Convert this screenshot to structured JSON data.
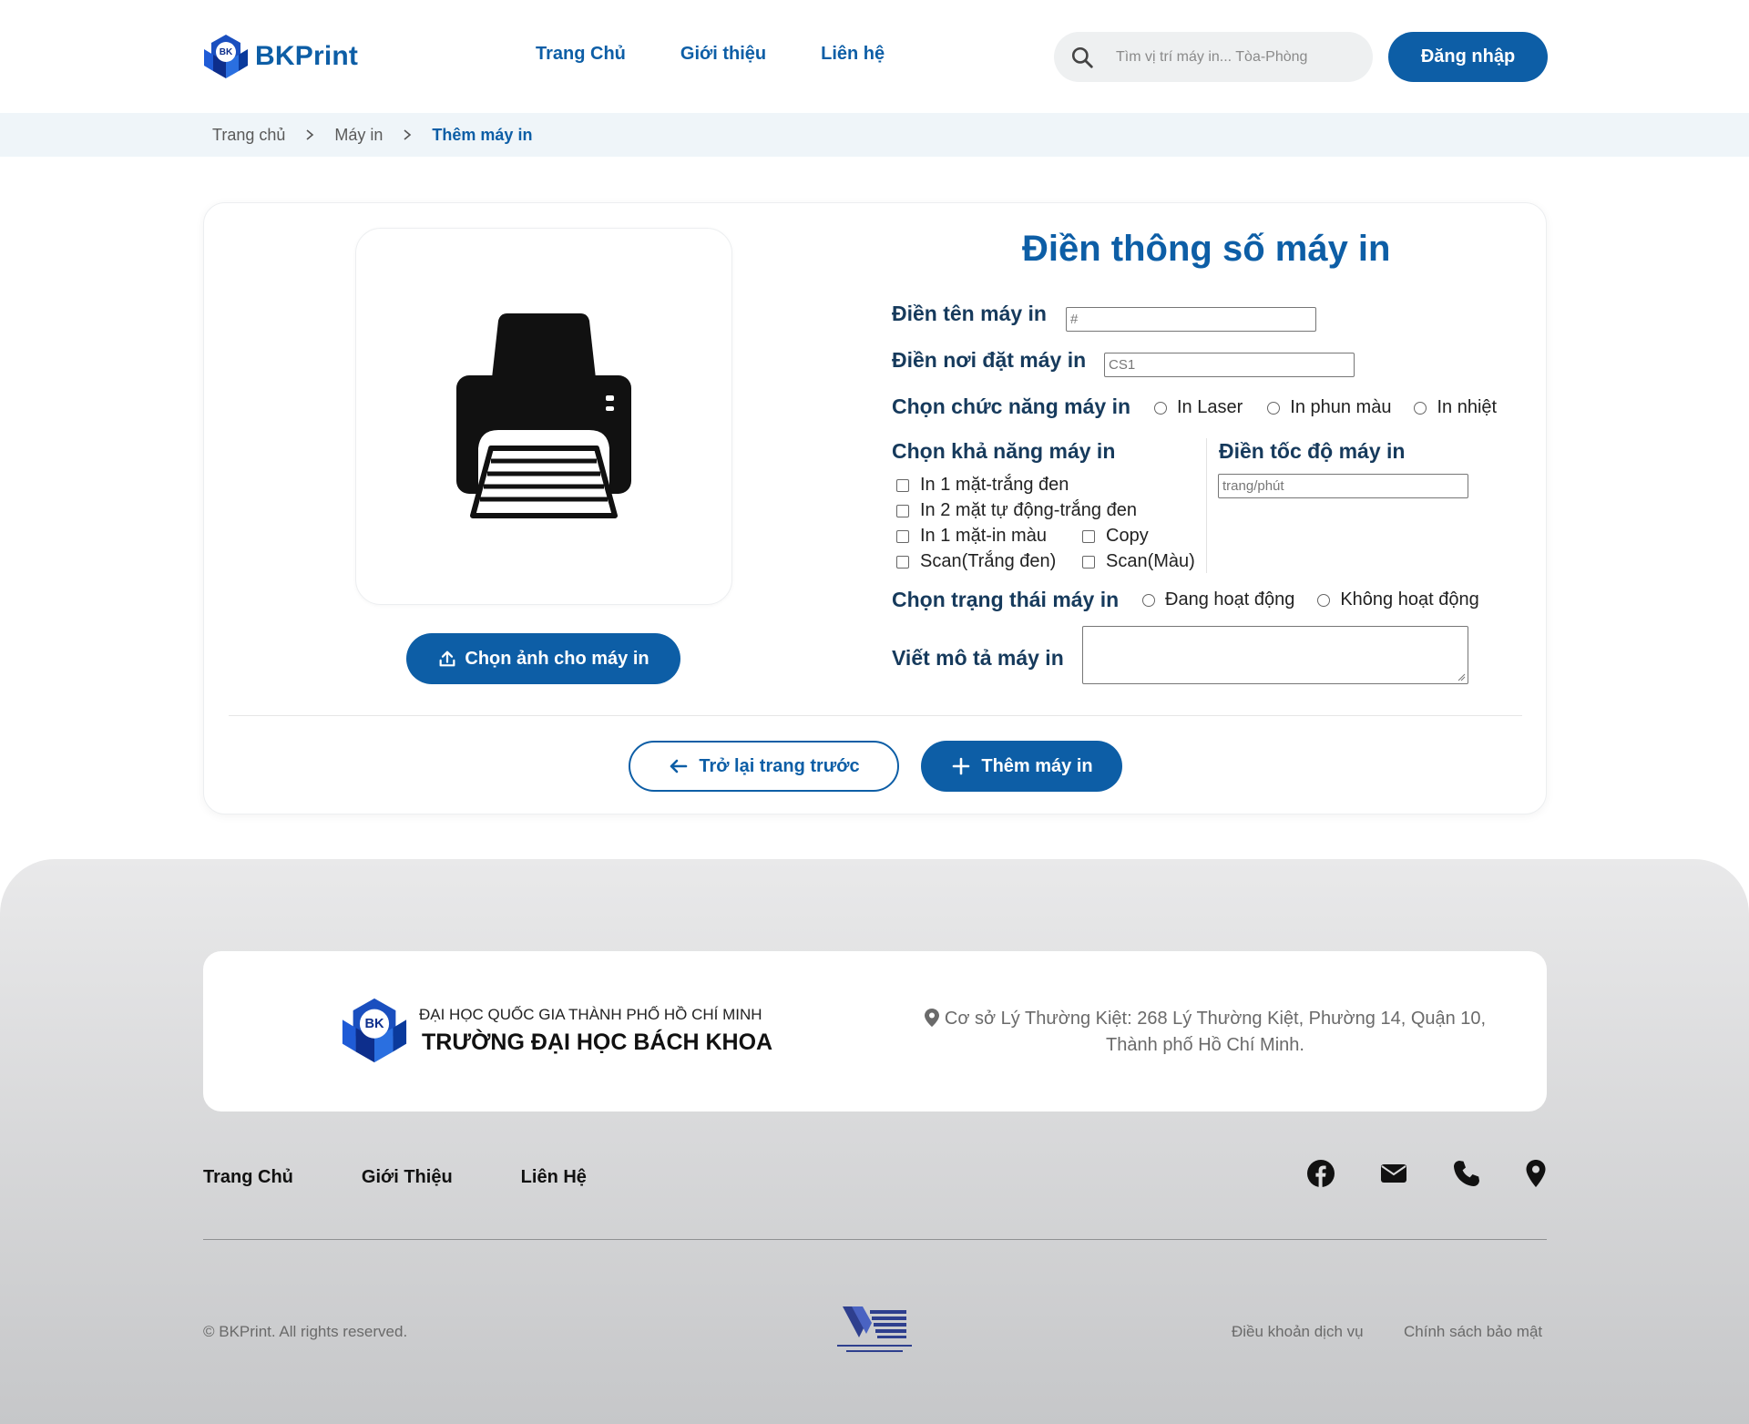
{
  "header": {
    "brand": "BKPrint",
    "nav": [
      "Trang Chủ",
      "Giới thiệu",
      "Liên hệ"
    ],
    "search_placeholder": "Tìm vị trí máy in... Tòa-Phòng",
    "login_label": "Đăng nhập"
  },
  "breadcrumb": {
    "items": [
      "Trang chủ",
      "Máy in"
    ],
    "current": "Thêm máy in"
  },
  "form": {
    "title": "Điền thông số máy in",
    "name_label": "Điền tên máy in",
    "name_placeholder": "#",
    "location_label": "Điền nơi đặt máy in",
    "location_placeholder": "CS1",
    "function_label": "Chọn chức năng máy in",
    "function_options": [
      "In Laser",
      "In phun màu",
      "In nhiệt"
    ],
    "capability_label": "Chọn khả năng máy in",
    "capabilities": [
      "In 1 mặt-trắng đen",
      "In 2 mặt tự động-trắng đen",
      "In 1 mặt-in màu",
      "Copy",
      "Scan(Trắng đen)",
      "Scan(Màu)"
    ],
    "speed_label": "Điền tốc độ máy in",
    "speed_placeholder": "trang/phút",
    "status_label": "Chọn trạng thái máy in",
    "status_options": [
      "Đang hoạt động",
      "Không hoạt động"
    ],
    "description_label": "Viết mô tả máy in",
    "choose_image_label": "Chọn ảnh cho máy in",
    "back_label": "Trở lại trang trước",
    "add_label": "Thêm máy in"
  },
  "footer": {
    "uni_line1": "ĐẠI HỌC QUỐC GIA THÀNH PHỐ HỒ CHÍ MINH",
    "uni_line2": "TRƯỜNG ĐẠI HỌC BÁCH KHOA",
    "address": "Cơ sở Lý Thường Kiệt: 268 Lý Thường Kiệt, Phường 14, Quận 10, Thành phố Hồ Chí Minh.",
    "nav": [
      "Trang Chủ",
      "Giới Thiệu",
      "Liên Hệ"
    ],
    "social_icons": [
      "facebook-icon",
      "mail-icon",
      "phone-icon",
      "location-icon"
    ],
    "copyright": "© BKPrint. All rights reserved.",
    "links": [
      "Điều khoản dịch vụ",
      "Chính sách bảo mật"
    ]
  },
  "colors": {
    "primary": "#0d5ea6",
    "breadcrumb_bg": "#eff5f9",
    "footer_top": "#e9e9ea",
    "footer_bottom": "#c6c7c9"
  }
}
